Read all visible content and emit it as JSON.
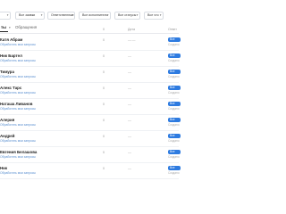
{
  "filters": {
    "f1": "",
    "f2": "Все заявки",
    "f3": "Ответственные",
    "f4": "Все исполнители",
    "f5": "Все статусы",
    "f6": "Все что"
  },
  "tabs": {
    "active": "ты",
    "inactive": "Обращения"
  },
  "columns": {
    "c1": "0",
    "c2": "Дата",
    "c3": "Ответ"
  },
  "rows": [
    {
      "name": "Катя Абрам",
      "sub": "Обработать мои запросы",
      "count": "0",
      "dash": "— —",
      "pill": "Все",
      "pill_sub": "Создано"
    },
    {
      "name": "Ник Бартел",
      "sub": "Обработать мои запросы",
      "count": "0",
      "dash": "—",
      "pill": "Все",
      "pill_sub": "Создано"
    },
    {
      "name": "Тимура",
      "sub": "Обработать мои запросы",
      "count": "0",
      "dash": "—",
      "pill": "Все",
      "pill_sub": "Создано"
    },
    {
      "name": "Алекс Тарс",
      "sub": "Обработать мои запросы",
      "count": "0",
      "dash": "—",
      "pill": "Все",
      "pill_sub": "Создано"
    },
    {
      "name": "Наташа Ливанов",
      "sub": "Обработать мои запросы",
      "count": "0",
      "dash": "—",
      "pill": "Все",
      "pill_sub": "Создано"
    },
    {
      "name": "Алерия",
      "sub": "Обработать мои запросы",
      "count": "0",
      "dash": "—",
      "pill": "Все",
      "pill_sub": "Создано"
    },
    {
      "name": "Андрей",
      "sub": "Обработать мои запросы",
      "count": "0",
      "dash": "—",
      "pill": "Все",
      "pill_sub": "Создано"
    },
    {
      "name": "Евгения Белашова",
      "sub": "Обработать мои запросы",
      "count": "0",
      "dash": "—",
      "pill": "Все",
      "pill_sub": "Создано"
    },
    {
      "name": "Ник",
      "sub": "Обработать мои запросы",
      "count": "0",
      "dash": "—",
      "pill": "Все",
      "pill_sub": "Создано"
    }
  ]
}
